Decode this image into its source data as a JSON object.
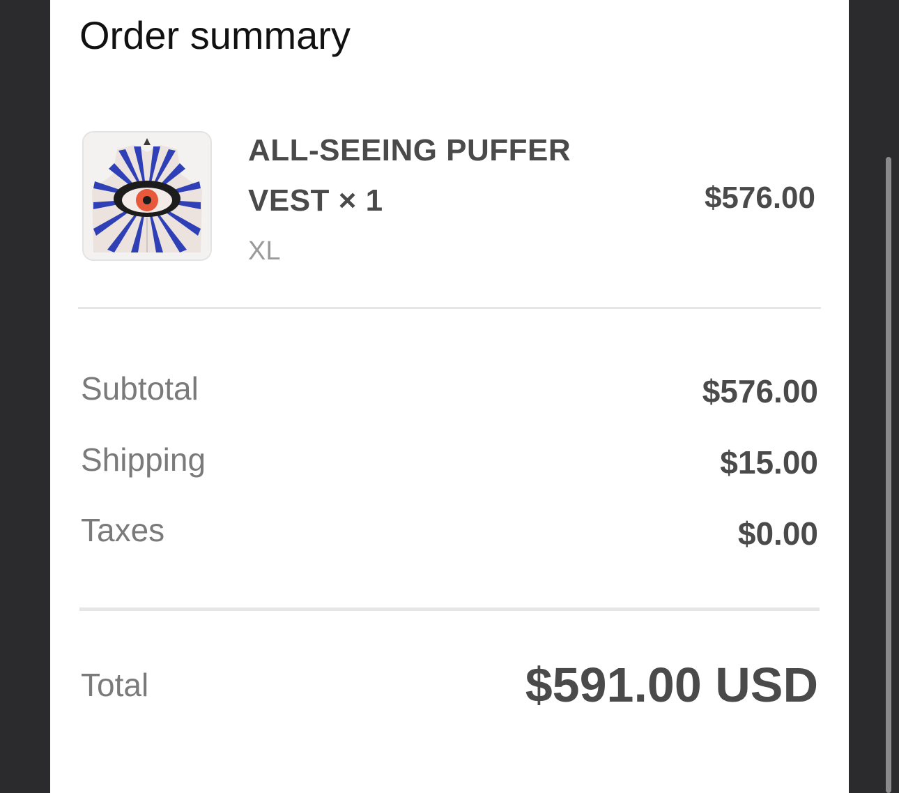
{
  "summary": {
    "title": "Order summary"
  },
  "line_item": {
    "name": "ALL-SEEING PUFFER VEST × 1",
    "variant": "XL",
    "price": "$576.00",
    "thumbnail_icon": "puffer-vest-eye-image"
  },
  "totals": {
    "subtotal_label": "Subtotal",
    "subtotal_value": "$576.00",
    "shipping_label": "Shipping",
    "shipping_value": "$15.00",
    "taxes_label": "Taxes",
    "taxes_value": "$0.00",
    "total_label": "Total",
    "total_value": "$591.00 USD"
  },
  "colors": {
    "background": "#2b2b2d",
    "panel": "#ffffff",
    "text_dark": "#4a4a4a",
    "text_muted": "#7a7a7a",
    "vest_blue": "#2f3fb5",
    "eye_orange": "#e8583a"
  }
}
